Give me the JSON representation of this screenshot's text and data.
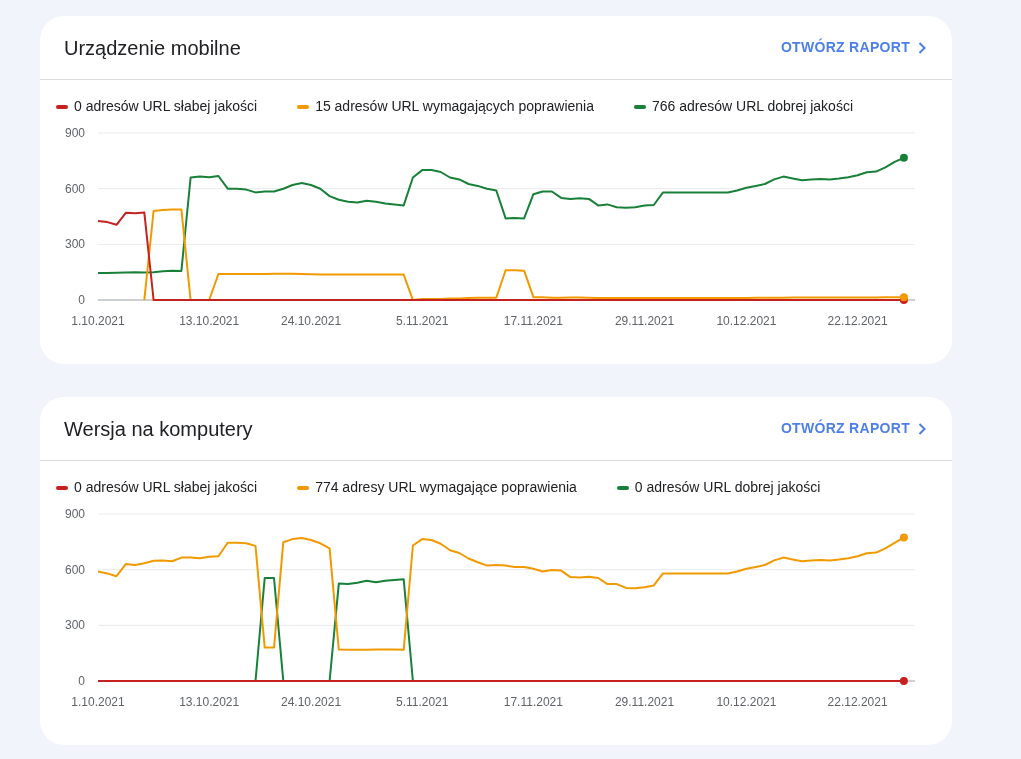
{
  "sections": [
    {
      "title": "Urządzenie mobilne",
      "link": "OTWÓRZ RAPORT",
      "chart_data": {
        "type": "line",
        "categories": [
          "1.10.2021",
          null,
          null,
          null,
          null,
          null,
          null,
          null,
          null,
          null,
          null,
          null,
          "13.10.2021",
          null,
          null,
          null,
          null,
          null,
          null,
          null,
          null,
          null,
          null,
          "24.10.2021",
          null,
          null,
          null,
          null,
          null,
          null,
          null,
          null,
          null,
          null,
          null,
          "5.11.2021",
          null,
          null,
          null,
          null,
          null,
          null,
          null,
          null,
          null,
          null,
          null,
          "17.11.2021",
          null,
          null,
          null,
          null,
          null,
          null,
          null,
          null,
          null,
          null,
          null,
          "29.11.2021",
          null,
          null,
          null,
          null,
          null,
          null,
          null,
          null,
          null,
          null,
          "10.12.2021",
          null,
          null,
          null,
          null,
          null,
          null,
          null,
          null,
          null,
          null,
          null,
          "22.12.2021",
          null,
          null,
          null,
          null,
          null
        ],
        "ylim": [
          0,
          900
        ],
        "yticks": [
          0,
          300,
          600,
          900
        ],
        "series": [
          {
            "name": "0 adresów URL słabej jakości",
            "color": "#c5221f",
            "values": [
              425,
              420,
              405,
              470,
              468,
              472,
              0,
              0,
              0,
              0,
              0,
              0,
              0,
              0,
              0,
              0,
              0,
              0,
              0,
              0,
              0,
              0,
              0,
              0,
              0,
              0,
              0,
              0,
              0,
              0,
              0,
              0,
              0,
              0,
              0,
              0,
              0,
              0,
              0,
              0,
              0,
              0,
              0,
              0,
              0,
              0,
              0,
              0,
              0,
              0,
              0,
              0,
              0,
              0,
              0,
              0,
              0,
              0,
              0,
              0,
              0,
              0,
              0,
              0,
              0,
              0,
              0,
              0,
              0,
              0,
              0,
              0,
              0,
              0,
              0,
              0,
              0,
              0,
              0,
              0,
              0,
              0,
              0,
              0,
              0,
              0,
              0,
              0
            ]
          },
          {
            "name": "15 adresów URL wymagających poprawienia",
            "color": "#f29900",
            "values": [
              null,
              null,
              null,
              null,
              null,
              0,
              480,
              485,
              487,
              487,
              0,
              null,
              0,
              140,
              140,
              140,
              140,
              140,
              140,
              141,
              141,
              141,
              140,
              139,
              138,
              137,
              137,
              137,
              137,
              137,
              137,
              137,
              137,
              137,
              0,
              5,
              5,
              5,
              8,
              8,
              10,
              12,
              12,
              12,
              160,
              160,
              158,
              15,
              15,
              12,
              12,
              13,
              14,
              12,
              10,
              10,
              10,
              10,
              10,
              10,
              10,
              10,
              10,
              10,
              10,
              10,
              10,
              10,
              10,
              10,
              10,
              12,
              12,
              12,
              12,
              13,
              13,
              13,
              14,
              14,
              14,
              14,
              14,
              14,
              14,
              15,
              15,
              15
            ]
          },
          {
            "name": "766 adresów URL dobrej jakości",
            "color": "#188038",
            "values": [
              145,
              145,
              147,
              148,
              150,
              148,
              150,
              155,
              158,
              157,
              660,
              665,
              662,
              668,
              600,
              600,
              595,
              580,
              585,
              585,
              600,
              620,
              630,
              620,
              600,
              560,
              540,
              530,
              525,
              535,
              530,
              520,
              515,
              510,
              660,
              700,
              700,
              690,
              660,
              650,
              625,
              615,
              600,
              590,
              440,
              442,
              440,
              570,
              585,
              585,
              550,
              545,
              548,
              545,
              510,
              515,
              500,
              497,
              500,
              510,
              512,
              580,
              580,
              580,
              580,
              580,
              580,
              580,
              580,
              590,
              605,
              615,
              625,
              650,
              665,
              655,
              645,
              650,
              652,
              650,
              655,
              662,
              672,
              688,
              692,
              715,
              745,
              766
            ]
          }
        ]
      }
    },
    {
      "title": "Wersja na komputery",
      "link": "OTWÓRZ RAPORT",
      "chart_data": {
        "type": "line",
        "categories": [
          "1.10.2021",
          null,
          null,
          null,
          null,
          null,
          null,
          null,
          null,
          null,
          null,
          null,
          "13.10.2021",
          null,
          null,
          null,
          null,
          null,
          null,
          null,
          null,
          null,
          null,
          "24.10.2021",
          null,
          null,
          null,
          null,
          null,
          null,
          null,
          null,
          null,
          null,
          null,
          "5.11.2021",
          null,
          null,
          null,
          null,
          null,
          null,
          null,
          null,
          null,
          null,
          null,
          "17.11.2021",
          null,
          null,
          null,
          null,
          null,
          null,
          null,
          null,
          null,
          null,
          null,
          "29.11.2021",
          null,
          null,
          null,
          null,
          null,
          null,
          null,
          null,
          null,
          null,
          "10.12.2021",
          null,
          null,
          null,
          null,
          null,
          null,
          null,
          null,
          null,
          null,
          null,
          "22.12.2021",
          null,
          null,
          null,
          null,
          null
        ],
        "ylim": [
          0,
          900
        ],
        "yticks": [
          0,
          300,
          600,
          900
        ],
        "series": [
          {
            "name": "0 adresów URL słabej jakości",
            "color": "#c5221f",
            "values": [
              0,
              0,
              0,
              0,
              0,
              0,
              0,
              0,
              0,
              0,
              0,
              0,
              0,
              0,
              0,
              0,
              0,
              0,
              0,
              0,
              0,
              0,
              0,
              0,
              0,
              0,
              0,
              0,
              0,
              0,
              0,
              0,
              0,
              0,
              0,
              0,
              0,
              0,
              0,
              0,
              0,
              0,
              0,
              0,
              0,
              0,
              0,
              0,
              0,
              0,
              0,
              0,
              0,
              0,
              0,
              0,
              0,
              0,
              0,
              0,
              0,
              0,
              0,
              0,
              0,
              0,
              0,
              0,
              0,
              0,
              0,
              0,
              0,
              0,
              0,
              0,
              0,
              0,
              0,
              0,
              0,
              0,
              0,
              0,
              0,
              0,
              0,
              0
            ]
          },
          {
            "name": "774 adresy URL wymagające poprawienia",
            "color": "#f29900",
            "values": [
              590,
              580,
              565,
              630,
              625,
              635,
              648,
              650,
              645,
              665,
              665,
              662,
              670,
              672,
              745,
              745,
              742,
              728,
              180,
              180,
              748,
              765,
              770,
              760,
              742,
              715,
              170,
              168,
              168,
              168,
              170,
              170,
              170,
              168,
              730,
              765,
              760,
              740,
              705,
              690,
              660,
              640,
              622,
              625,
              622,
              615,
              615,
              605,
              590,
              598,
              595,
              560,
              558,
              562,
              555,
              522,
              522,
              502,
              500,
              505,
              515,
              580,
              580,
              580,
              580,
              580,
              580,
              580,
              580,
              590,
              605,
              615,
              625,
              650,
              665,
              655,
              645,
              650,
              652,
              650,
              655,
              662,
              672,
              688,
              692,
              715,
              745,
              774
            ]
          },
          {
            "name": "0 adresów URL dobrej jakości",
            "color": "#188038",
            "values": [
              null,
              null,
              null,
              null,
              null,
              null,
              null,
              null,
              null,
              null,
              null,
              null,
              null,
              null,
              null,
              null,
              null,
              0,
              555,
              555,
              0,
              null,
              null,
              null,
              null,
              0,
              525,
              522,
              530,
              540,
              532,
              540,
              545,
              548,
              0,
              null,
              null,
              null,
              null,
              null,
              null,
              null,
              null,
              null,
              null,
              null,
              null,
              null,
              null,
              null,
              null,
              null,
              null,
              null,
              null,
              null,
              null,
              null,
              null,
              null,
              null,
              null,
              null,
              null,
              null,
              null,
              null,
              null,
              null,
              null,
              null,
              null,
              null,
              null,
              null,
              null,
              null,
              null,
              null,
              null,
              null,
              null,
              null,
              null,
              null,
              null,
              null,
              null
            ]
          }
        ]
      }
    }
  ]
}
